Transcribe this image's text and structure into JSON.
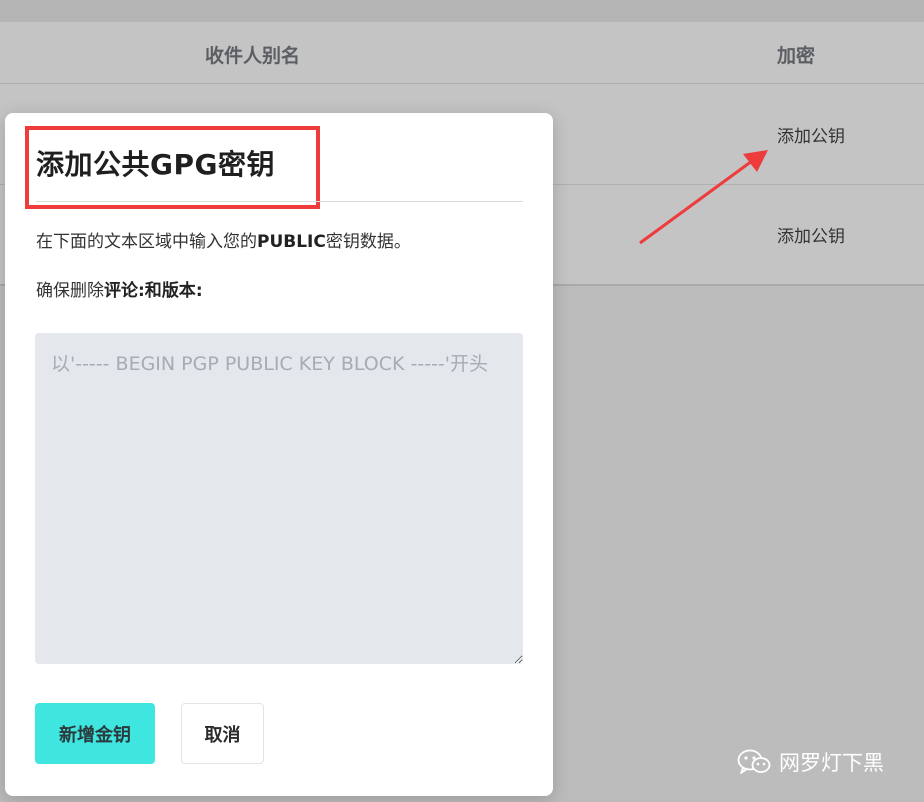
{
  "table": {
    "headers": {
      "alias": "收件人别名",
      "encrypt": "加密"
    },
    "rows": [
      {
        "action": "添加公钥"
      },
      {
        "action": "添加公钥"
      }
    ]
  },
  "modal": {
    "title": "添加公共GPG密钥",
    "description": {
      "pre": "在下面的文本区域中输入您的",
      "bold": "PUBLIC",
      "post": "密钥数据。"
    },
    "note": {
      "pre": "确保删除",
      "bold1": "评论",
      "sep": ":和",
      "bold2": "版本",
      "end": ":"
    },
    "key_field": {
      "placeholder": "以'----- BEGIN PGP PUBLIC KEY BLOCK -----'开头",
      "value": ""
    },
    "buttons": {
      "add": "新增金钥",
      "cancel": "取消"
    }
  },
  "annotations": {
    "highlight_color": "#ee3b3b",
    "arrow_color": "#ee3b3b"
  },
  "watermark": {
    "text": "网罗灯下黑",
    "icon": "wechat-icon"
  }
}
